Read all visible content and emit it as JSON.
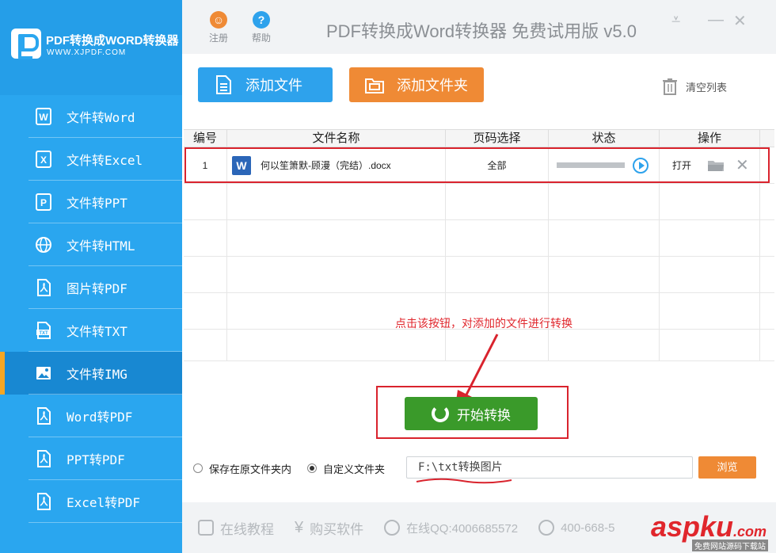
{
  "app": {
    "logo_title": "PDF转换成WORD转换器",
    "logo_url": "WWW.XJPDF.COM",
    "window_title": "PDF转换成Word转换器 免费试用版 v5.0"
  },
  "topbar": {
    "register_label": "注册",
    "help_label": "帮助",
    "minimize_glyph": "⩡",
    "close_glyph": "✕"
  },
  "sidebar": {
    "items": [
      {
        "label": "文件转Word",
        "icon": "word-icon"
      },
      {
        "label": "文件转Excel",
        "icon": "excel-icon"
      },
      {
        "label": "文件转PPT",
        "icon": "ppt-icon"
      },
      {
        "label": "文件转HTML",
        "icon": "globe-icon"
      },
      {
        "label": "图片转PDF",
        "icon": "pdf-icon"
      },
      {
        "label": "文件转TXT",
        "icon": "txt-icon"
      },
      {
        "label": "文件转IMG",
        "icon": "image-icon",
        "active": true
      },
      {
        "label": "Word转PDF",
        "icon": "pdf-icon"
      },
      {
        "label": "PPT转PDF",
        "icon": "pdf-icon"
      },
      {
        "label": "Excel转PDF",
        "icon": "pdf-icon"
      }
    ]
  },
  "actions": {
    "add_file": "添加文件",
    "add_folder": "添加文件夹",
    "clear_list": "清空列表"
  },
  "table": {
    "headers": [
      "编号",
      "文件名称",
      "页码选择",
      "状态",
      "操作"
    ],
    "rows": [
      {
        "no": "1",
        "file_icon": "W",
        "name": "何以笙箫默-顾漫（完结）.docx",
        "page": "全部",
        "open": "打开"
      }
    ]
  },
  "annotation": "点击该按钮，对添加的文件进行转换",
  "start_button": "开始转换",
  "save": {
    "option_original": "保存在原文件夹内",
    "option_custom": "自定义文件夹",
    "path": "F:\\txt转换图片",
    "browse": "浏览"
  },
  "bottom": {
    "tutorial": "在线教程",
    "buy": "购买软件",
    "qq": "在线QQ:4006685572",
    "phone": "400-668-5"
  },
  "watermark": {
    "text": "aspku",
    "domain": ".com",
    "sub": "免费网站源码下载站"
  },
  "colors": {
    "sidebar": "#2aa6ef",
    "active": "#1888d2",
    "blue_btn": "#2ea2ec",
    "orange_btn": "#ef8a35",
    "start_btn": "#3a9a2a",
    "annotation_red": "#e0262c"
  }
}
